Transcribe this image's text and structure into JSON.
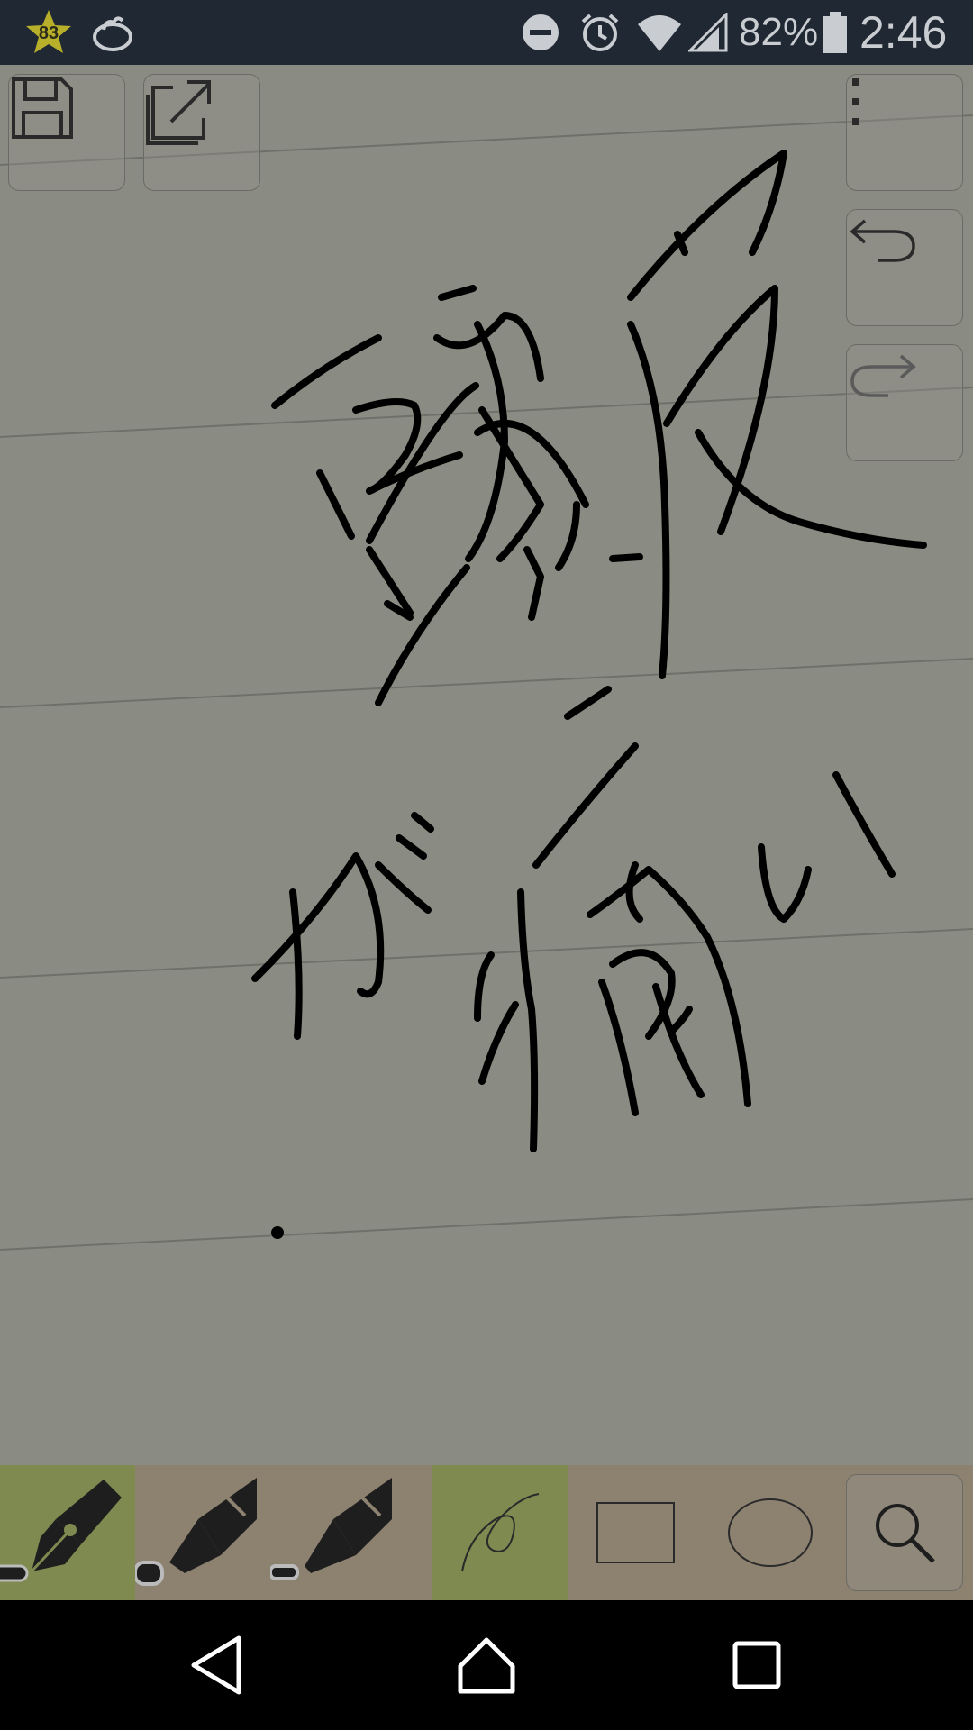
{
  "status_bar": {
    "badge_count": "83",
    "battery_percent": "82%",
    "time": "2:46"
  },
  "canvas": {
    "background_color": "#8a8b82",
    "ruled_line_color": "#6f706a",
    "ink_color": "#000000",
    "handwriting": "頭皮が痛い"
  },
  "top_buttons": [
    {
      "name": "save",
      "icon": "floppy-disk-icon"
    },
    {
      "name": "export",
      "icon": "share-export-icon"
    }
  ],
  "side_buttons": [
    {
      "name": "more-options",
      "icon": "vertical-dots-icon"
    },
    {
      "name": "undo",
      "icon": "undo-arrow-icon"
    },
    {
      "name": "redo",
      "icon": "redo-arrow-icon"
    }
  ],
  "toolbar": {
    "tools": [
      {
        "name": "fountain-pen",
        "icon": "fountain-pen-icon",
        "active": true
      },
      {
        "name": "marker-thick",
        "icon": "marker-icon",
        "active": false
      },
      {
        "name": "marker-thin",
        "icon": "marker-icon",
        "active": false
      },
      {
        "name": "freehand",
        "icon": "freehand-curve-icon",
        "active": true
      },
      {
        "name": "rectangle",
        "icon": "rectangle-icon",
        "active": false
      },
      {
        "name": "ellipse",
        "icon": "ellipse-icon",
        "active": false
      },
      {
        "name": "zoom",
        "icon": "magnifier-icon",
        "active": false
      }
    ],
    "active_color": "#7e8a4f",
    "bar_color": "#8d8170"
  },
  "nav_bar": {
    "buttons": [
      "back",
      "home",
      "recents"
    ]
  }
}
